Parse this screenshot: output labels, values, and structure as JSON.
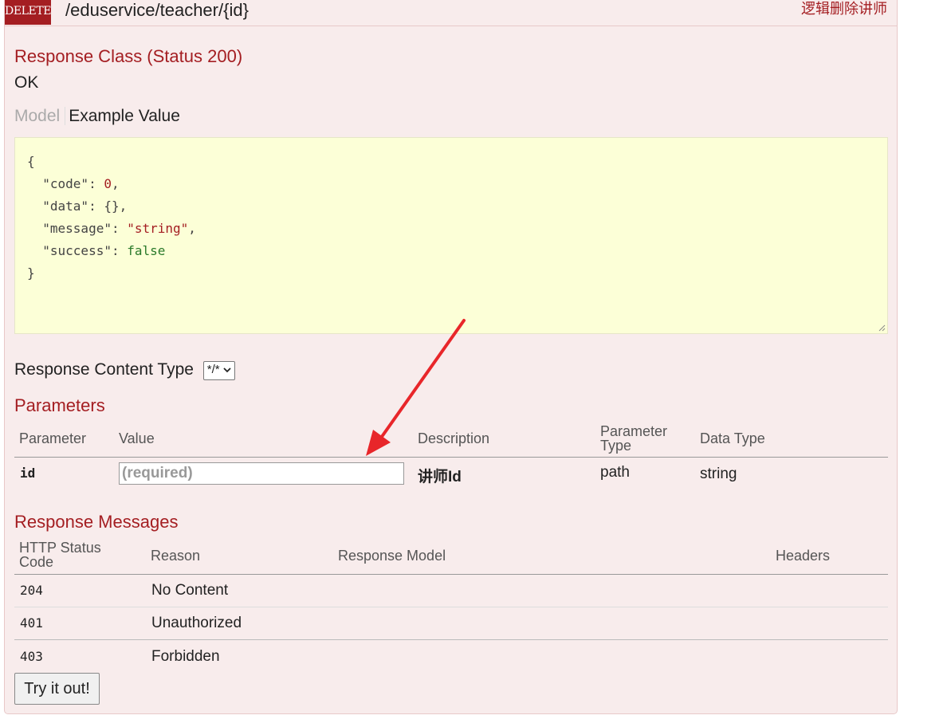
{
  "operation": {
    "method": "DELETE",
    "path": "/eduservice/teacher/{id}",
    "summary": "逻辑删除讲师"
  },
  "response_class": {
    "title": "Response Class (Status 200)",
    "status_text": "OK",
    "tabs": {
      "model": "Model",
      "example": "Example Value"
    },
    "example_lines": [
      {
        "open": "{"
      },
      {
        "key": "\"code\"",
        "value": "0",
        "type": "num",
        "trail": ","
      },
      {
        "key": "\"data\"",
        "value": "{}",
        "type": "plain",
        "trail": ","
      },
      {
        "key": "\"message\"",
        "value": "\"string\"",
        "type": "str",
        "trail": ","
      },
      {
        "key": "\"success\"",
        "value": "false",
        "type": "bool",
        "trail": ""
      },
      {
        "close": "}"
      }
    ]
  },
  "content_type": {
    "label": "Response Content Type",
    "selected": "*/*"
  },
  "parameters": {
    "title": "Parameters",
    "headers": [
      "Parameter",
      "Value",
      "Description",
      "Parameter Type",
      "Data Type"
    ],
    "rows": [
      {
        "name": "id",
        "placeholder": "(required)",
        "description": "讲师Id",
        "param_type": "path",
        "data_type": "string"
      }
    ]
  },
  "response_messages": {
    "title": "Response Messages",
    "headers": [
      "HTTP Status Code",
      "Reason",
      "Response Model",
      "Headers"
    ],
    "rows": [
      {
        "code": "204",
        "reason": "No Content"
      },
      {
        "code": "401",
        "reason": "Unauthorized"
      },
      {
        "code": "403",
        "reason": "Forbidden"
      }
    ]
  },
  "try_button": "Try it out!",
  "colors": {
    "method": "#a41e22",
    "panel": "#f8ecec",
    "example_bg": "#fcffd7",
    "annotation_arrow": "#e8262a"
  }
}
